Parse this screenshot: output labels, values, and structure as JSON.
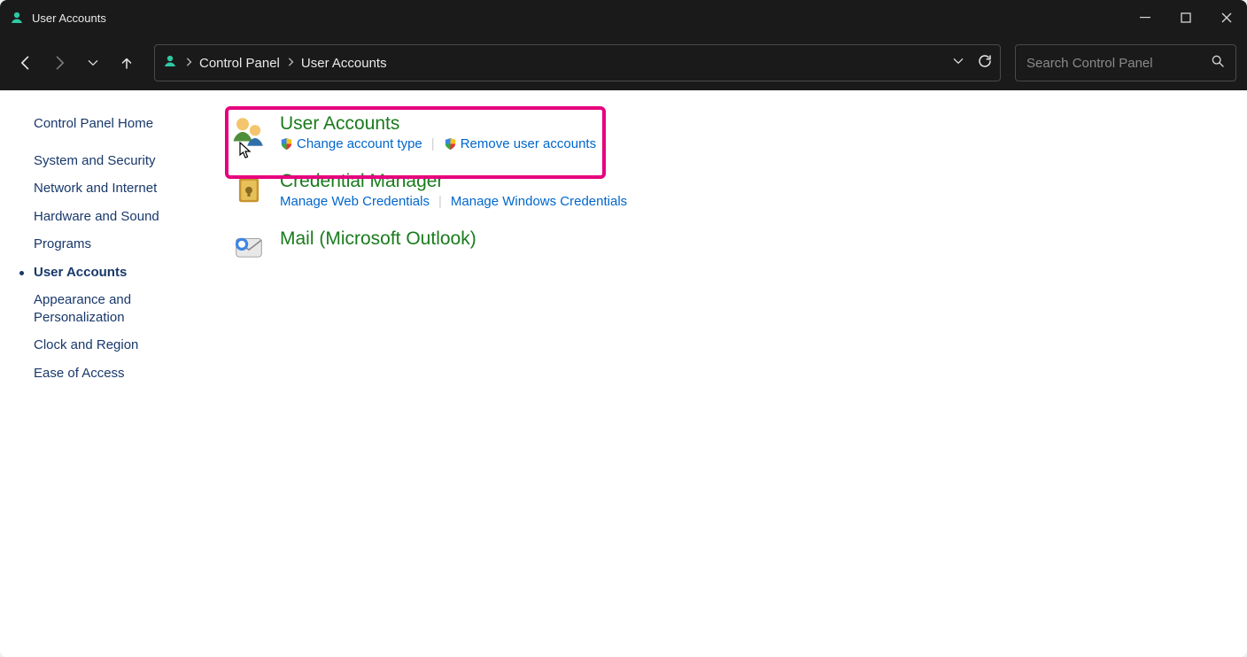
{
  "window": {
    "title": "User Accounts"
  },
  "breadcrumb": {
    "root": "Control Panel",
    "current": "User Accounts"
  },
  "search": {
    "placeholder": "Search Control Panel"
  },
  "sidebar": {
    "items": [
      {
        "label": "Control Panel Home",
        "active": false
      },
      {
        "label": "System and Security",
        "active": false
      },
      {
        "label": "Network and Internet",
        "active": false
      },
      {
        "label": "Hardware and Sound",
        "active": false
      },
      {
        "label": "Programs",
        "active": false
      },
      {
        "label": "User Accounts",
        "active": true
      },
      {
        "label": "Appearance and Personalization",
        "active": false
      },
      {
        "label": "Clock and Region",
        "active": false
      },
      {
        "label": "Ease of Access",
        "active": false
      }
    ]
  },
  "main": {
    "sections": [
      {
        "heading": "User Accounts",
        "links": [
          {
            "label": "Change account type",
            "shield": true
          },
          {
            "label": "Remove user accounts",
            "shield": true
          }
        ]
      },
      {
        "heading": "Credential Manager",
        "links": [
          {
            "label": "Manage Web Credentials",
            "shield": false
          },
          {
            "label": "Manage Windows Credentials",
            "shield": false
          }
        ]
      },
      {
        "heading": "Mail (Microsoft Outlook)",
        "links": []
      }
    ]
  }
}
